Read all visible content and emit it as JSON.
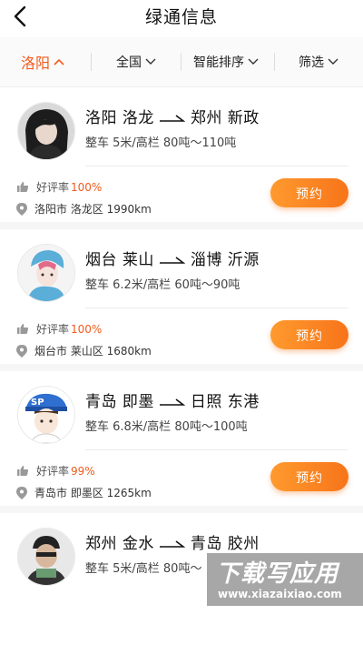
{
  "header": {
    "title": "绿通信息"
  },
  "filters": [
    {
      "label": "洛阳",
      "active": true
    },
    {
      "label": "全国",
      "active": false
    },
    {
      "label": "智能排序",
      "active": false
    },
    {
      "label": "筛选",
      "active": false
    }
  ],
  "colors": {
    "accent": "#f25a1c",
    "button_start": "#ff9a2e",
    "button_end": "#f7741a"
  },
  "listings": [
    {
      "from": "洛阳 洛龙",
      "to": "郑州 新政",
      "spec": "整车 5米/高栏 80吨～110吨",
      "rating_label": "好评率",
      "rating_value": "100%",
      "location": "洛阳市 洛龙区 1990km",
      "button": "预约"
    },
    {
      "from": "烟台 莱山",
      "to": "淄博 沂源",
      "spec": "整车 6.2米/高栏 60吨～90吨",
      "rating_label": "好评率",
      "rating_value": "100%",
      "location": "烟台市 莱山区 1680km",
      "button": "预约"
    },
    {
      "from": "青岛 即墨",
      "to": "日照 东港",
      "spec": "整车 6.8米/高栏 80吨～100吨",
      "rating_label": "好评率",
      "rating_value": "99%",
      "location": "青岛市 即墨区 1265km",
      "button": "预约"
    },
    {
      "from": "郑州 金水",
      "to": "青岛 胶州",
      "spec": "整车 5米/高栏 80吨～",
      "rating_label": "",
      "rating_value": "",
      "location": "",
      "button": ""
    }
  ],
  "watermark": {
    "main": "下载写应用",
    "sub": "www.xiazaixiao.com"
  }
}
